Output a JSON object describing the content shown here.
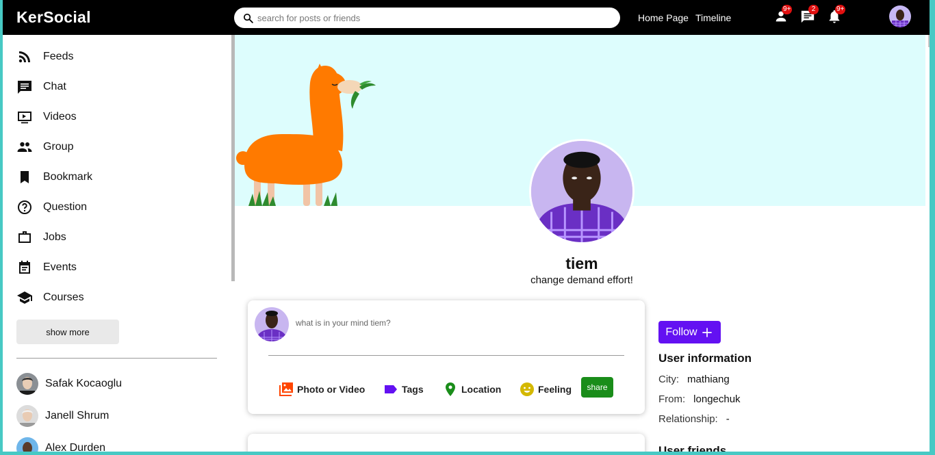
{
  "app": {
    "logo": "KerSocial"
  },
  "search": {
    "placeholder": "search for posts or friends"
  },
  "topnav": {
    "links": [
      "Home Page",
      "Timeline"
    ],
    "icons": [
      {
        "name": "person-icon",
        "badge": "9+"
      },
      {
        "name": "chat-icon",
        "badge": "2"
      },
      {
        "name": "notifications-icon",
        "badge": "9+"
      }
    ]
  },
  "sidebar": {
    "items": [
      {
        "icon": "rss-feed-icon",
        "label": "Feeds"
      },
      {
        "icon": "chat-icon",
        "label": "Chat"
      },
      {
        "icon": "play-circle-icon",
        "label": "Videos"
      },
      {
        "icon": "group-icon",
        "label": "Group"
      },
      {
        "icon": "bookmark-icon",
        "label": "Bookmark"
      },
      {
        "icon": "help-icon",
        "label": "Question"
      },
      {
        "icon": "work-icon",
        "label": "Jobs"
      },
      {
        "icon": "event-icon",
        "label": "Events"
      },
      {
        "icon": "school-icon",
        "label": "Courses"
      }
    ],
    "show_more": "show more",
    "friends": [
      "Safak Kocaoglu",
      "Janell Shrum",
      "Alex Durden"
    ]
  },
  "profile": {
    "name": "tiem",
    "bio": "change demand effort!"
  },
  "share": {
    "placeholder": "what is in your mind tiem?",
    "options": [
      {
        "icon": "perm-media-icon",
        "label": "Photo or Video",
        "color": "#ff4500"
      },
      {
        "icon": "label-icon",
        "label": "Tags",
        "color": "#6311f2"
      },
      {
        "icon": "room-icon",
        "label": "Location",
        "color": "#1a8d1a"
      },
      {
        "icon": "emoji-emotions-icon",
        "label": "Feeling",
        "color": "#d4b800"
      }
    ],
    "button": "share"
  },
  "userinfo": {
    "follow": "Follow",
    "title": "User information",
    "rows": [
      {
        "key": "City:",
        "value": "mathiang"
      },
      {
        "key": "From:",
        "value": "longechuk"
      },
      {
        "key": "Relationship:",
        "value": "-"
      }
    ],
    "friends_title": "User friends"
  },
  "colors": {
    "topbar": "#000000",
    "accent": "#6311f2",
    "cover": "#ddfdfd",
    "share": "#1a8d1a"
  }
}
